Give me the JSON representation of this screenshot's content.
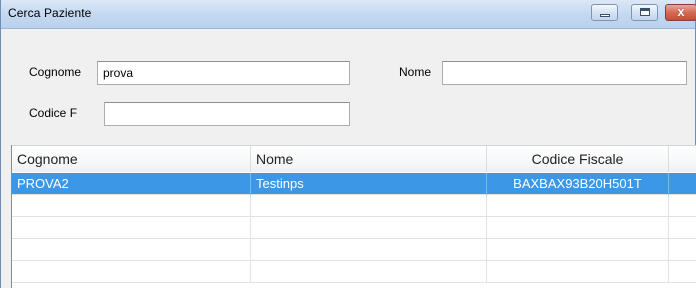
{
  "window": {
    "title": "Cerca Paziente",
    "controls": {
      "minimize": "minimize",
      "maximize": "maximize",
      "close": "x"
    }
  },
  "form": {
    "cognome_label": "Cognome",
    "cognome_value": "prova",
    "nome_label": "Nome",
    "nome_value": "",
    "codice_label": "Codice F",
    "codice_value": ""
  },
  "grid": {
    "columns": [
      "Cognome",
      "Nome",
      "Codice Fiscale"
    ],
    "rows": [
      {
        "cognome": "PROVA2",
        "nome": "Testinps",
        "codice_fiscale": "BAXBAX93B20H501T",
        "selected": true
      },
      {
        "cognome": "",
        "nome": "",
        "codice_fiscale": "",
        "selected": false
      },
      {
        "cognome": "",
        "nome": "",
        "codice_fiscale": "",
        "selected": false
      },
      {
        "cognome": "",
        "nome": "",
        "codice_fiscale": "",
        "selected": false
      },
      {
        "cognome": "",
        "nome": "",
        "codice_fiscale": "",
        "selected": false
      }
    ]
  },
  "colors": {
    "selection": "#3c97e6",
    "titlebar": "#c4d9f1",
    "close_button": "#c94c37"
  }
}
